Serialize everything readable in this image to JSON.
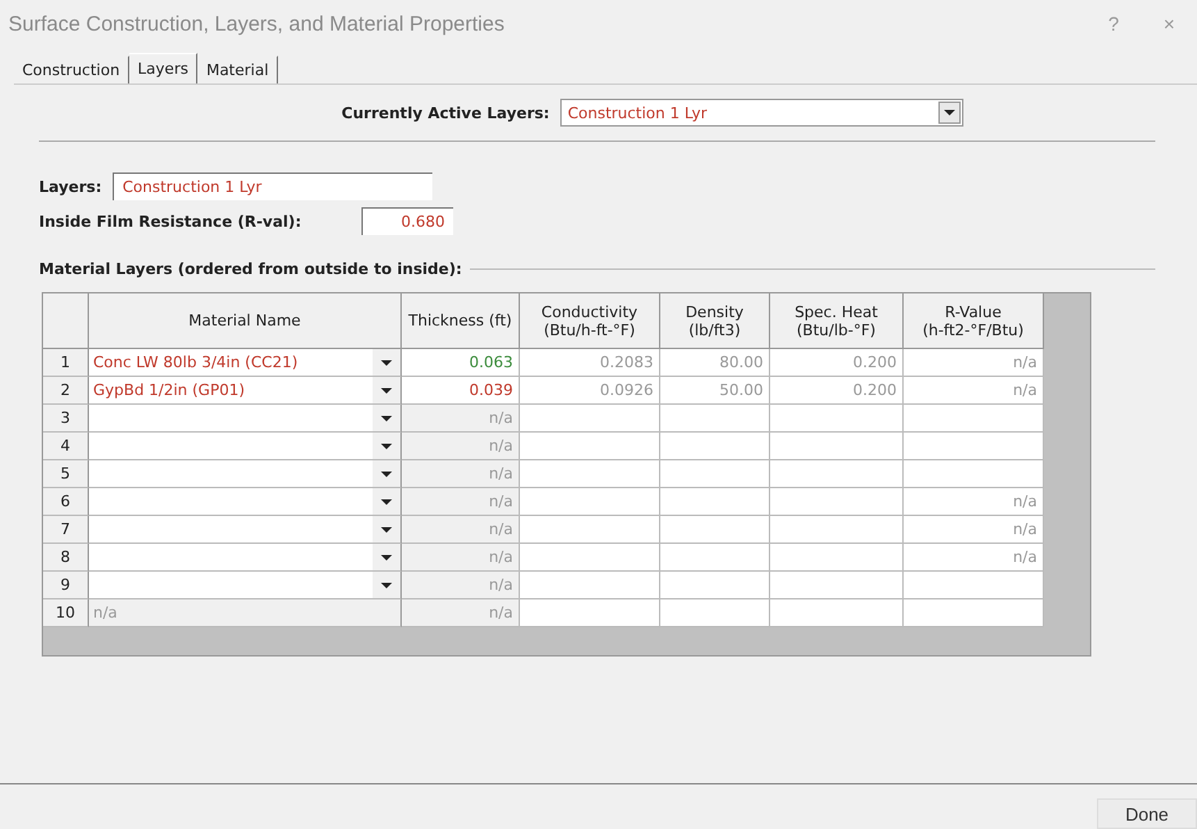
{
  "window": {
    "title": "Surface Construction, Layers, and Material Properties",
    "help": "?",
    "close": "×"
  },
  "tabs": [
    {
      "label": "Construction",
      "selected": false
    },
    {
      "label": "Layers",
      "selected": true
    },
    {
      "label": "Material",
      "selected": false
    }
  ],
  "active_layers": {
    "label": "Currently Active Layers:",
    "value": "Construction 1 Lyr"
  },
  "layers": {
    "label": "Layers:",
    "value": "Construction 1 Lyr"
  },
  "film_resistance": {
    "label": "Inside Film Resistance (R-val):",
    "value": "0.680"
  },
  "table": {
    "title": "Material Layers (ordered from outside to inside):",
    "columns": [
      "",
      "Material Name",
      "Thickness (ft)",
      "Conductivity\n(Btu/h-ft-°F)",
      "Density\n(lb/ft3)",
      "Spec. Heat\n(Btu/lb-°F)",
      "R-Value\n(h-ft2-°F/Btu)"
    ],
    "rows": [
      {
        "cells": [
          "1",
          "Conc LW 80lb 3/4in (CC21)",
          "0.063",
          "0.2083",
          "80.00",
          "0.200",
          "n/a"
        ],
        "dropdown": true,
        "name_readonly": false,
        "thickness_readonly": false,
        "thickness_valid": true
      },
      {
        "cells": [
          "2",
          "GypBd 1/2in (GP01)",
          "0.039",
          "0.0926",
          "50.00",
          "0.200",
          "n/a"
        ],
        "dropdown": true,
        "name_readonly": false,
        "thickness_readonly": false,
        "thickness_valid": false
      },
      {
        "cells": [
          "3",
          "",
          "n/a",
          "",
          "",
          "",
          ""
        ],
        "dropdown": true,
        "name_readonly": false,
        "thickness_readonly": true
      },
      {
        "cells": [
          "4",
          "",
          "n/a",
          "",
          "",
          "",
          ""
        ],
        "dropdown": true,
        "name_readonly": false,
        "thickness_readonly": true
      },
      {
        "cells": [
          "5",
          "",
          "n/a",
          "",
          "",
          "",
          ""
        ],
        "dropdown": true,
        "name_readonly": false,
        "thickness_readonly": true
      },
      {
        "cells": [
          "6",
          "",
          "n/a",
          "",
          "",
          "",
          "n/a"
        ],
        "dropdown": true,
        "name_readonly": false,
        "thickness_readonly": true
      },
      {
        "cells": [
          "7",
          "",
          "n/a",
          "",
          "",
          "",
          "n/a"
        ],
        "dropdown": true,
        "name_readonly": false,
        "thickness_readonly": true
      },
      {
        "cells": [
          "8",
          "",
          "n/a",
          "",
          "",
          "",
          "n/a"
        ],
        "dropdown": true,
        "name_readonly": false,
        "thickness_readonly": true
      },
      {
        "cells": [
          "9",
          "",
          "n/a",
          "",
          "",
          "",
          ""
        ],
        "dropdown": true,
        "name_readonly": false,
        "thickness_readonly": true
      },
      {
        "cells": [
          "10",
          "n/a",
          "n/a",
          "",
          "",
          "",
          ""
        ],
        "dropdown": false,
        "name_readonly": true,
        "thickness_readonly": true
      }
    ]
  },
  "done_button": "Done"
}
